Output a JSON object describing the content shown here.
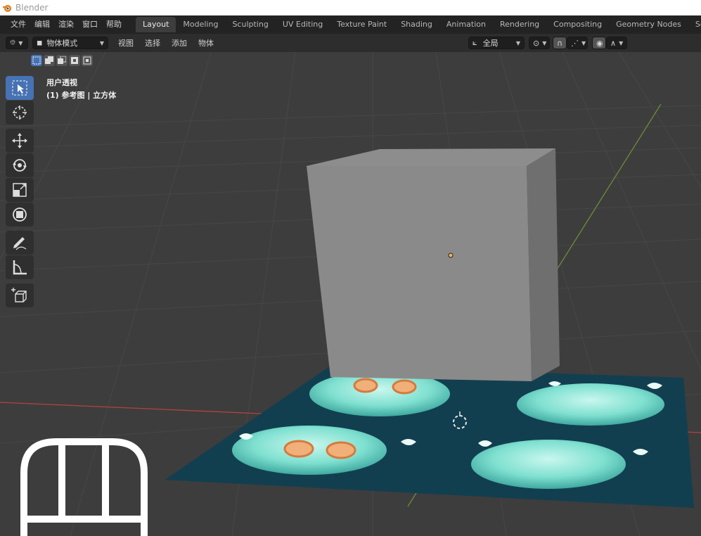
{
  "window": {
    "title": "Blender"
  },
  "menu": {
    "items": [
      "文件",
      "编辑",
      "渲染",
      "窗口",
      "帮助"
    ]
  },
  "workspaces": {
    "tabs": [
      "Layout",
      "Modeling",
      "Sculpting",
      "UV Editing",
      "Texture Paint",
      "Shading",
      "Animation",
      "Rendering",
      "Compositing",
      "Geometry Nodes",
      "Scripting"
    ],
    "active": "Layout"
  },
  "viewport_header": {
    "mode_label": "物体模式",
    "menus": [
      "视图",
      "选择",
      "添加",
      "物体"
    ],
    "transform_orientation": "全局"
  },
  "overlay": {
    "view_name": "用户透视",
    "object_info": "(1) 参考图 | 立方体"
  },
  "tools": [
    "select-box",
    "cursor",
    "move",
    "rotate",
    "scale",
    "transform",
    "annotate",
    "measure",
    "add-cube"
  ],
  "colors": {
    "accent": "#4772b3",
    "x_axis": "#b5423f",
    "y_axis": "#6a8d39",
    "background": "#3d3d3d"
  }
}
